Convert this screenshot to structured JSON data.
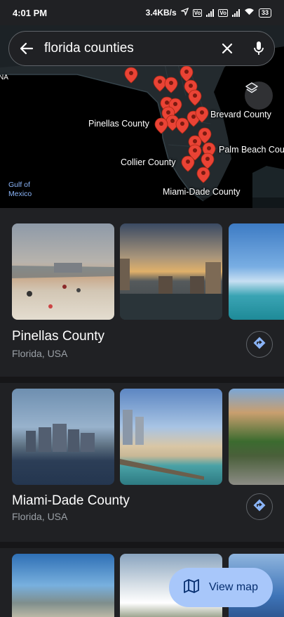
{
  "status_bar": {
    "time": "4:01 PM",
    "net_speed": "3.4KB/s",
    "battery": "33"
  },
  "search": {
    "query": "florida counties"
  },
  "map": {
    "labels": {
      "pinellas": "Pinellas County",
      "brevard": "Brevard County",
      "palm_beach": "Palm Beach Cou",
      "collier": "Collier County",
      "miami_dade": "Miami-Dade County",
      "na": "NA",
      "gulf": "Gulf of",
      "mexico": "Mexico"
    }
  },
  "results": [
    {
      "title": "Pinellas County",
      "subtitle": "Florida, USA"
    },
    {
      "title": "Miami-Dade County",
      "subtitle": "Florida, USA"
    }
  ],
  "fab": {
    "label": "View map"
  },
  "colors": {
    "accent": "#a8c7fa",
    "pin": "#ea4335",
    "background": "#202124"
  }
}
